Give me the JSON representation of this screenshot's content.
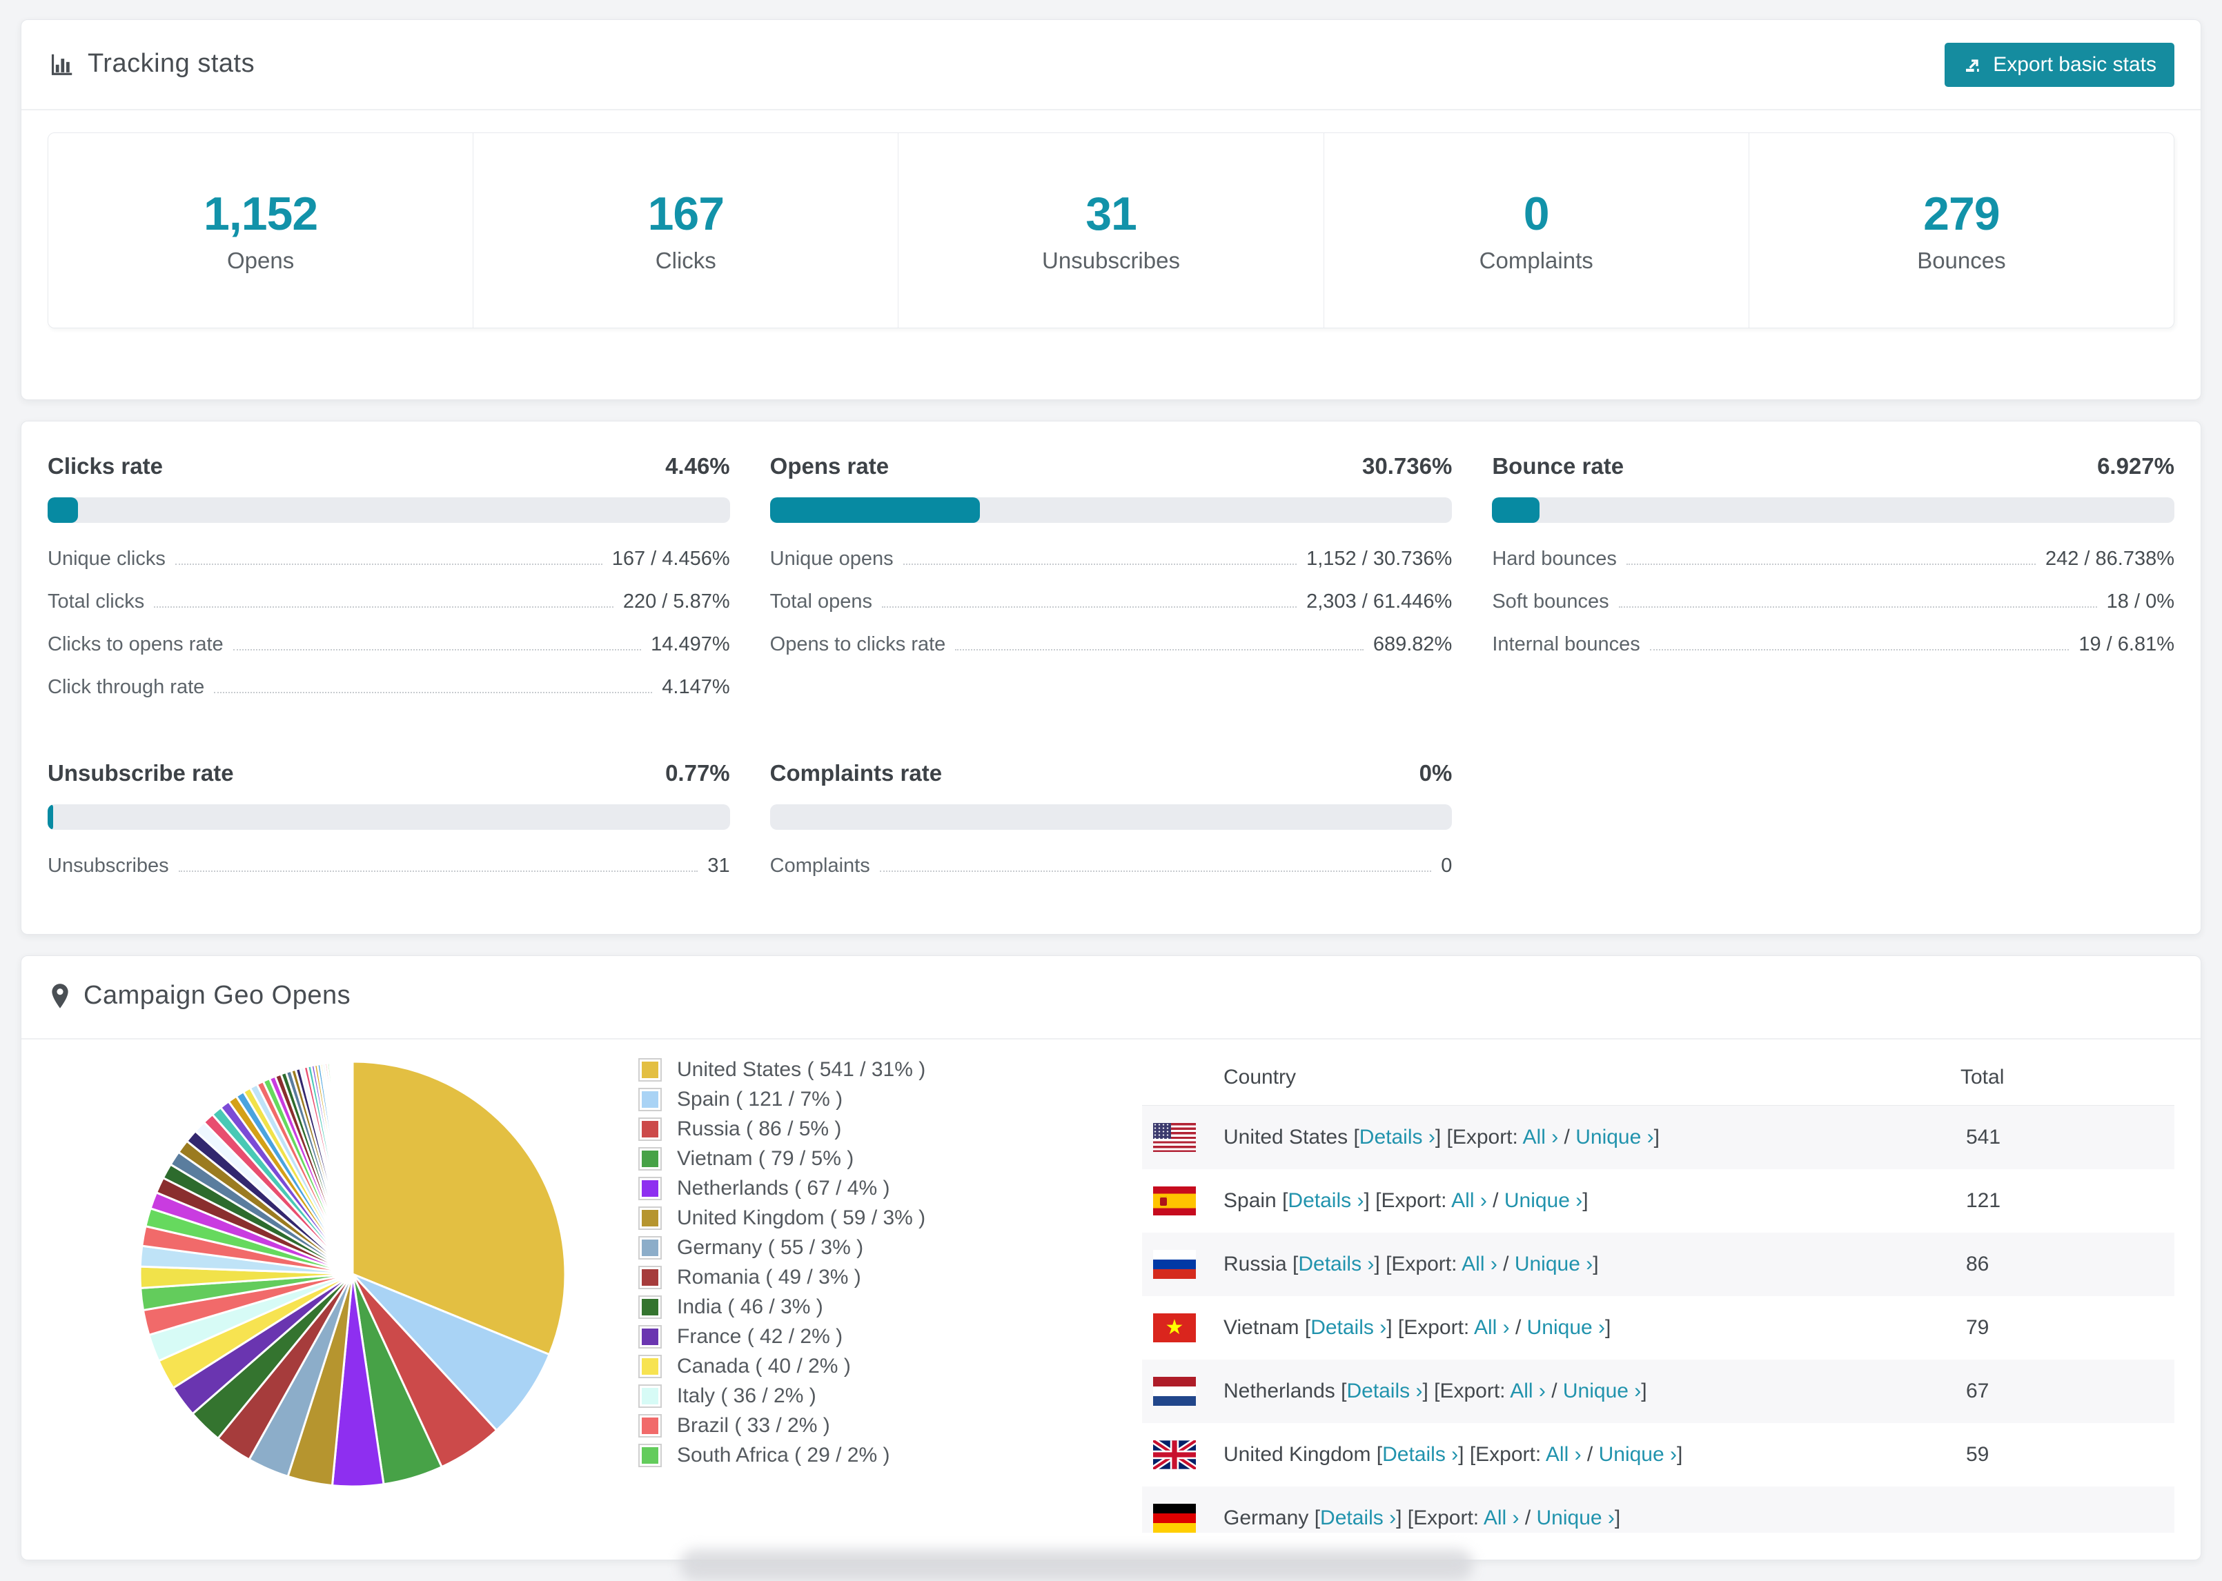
{
  "colors": {
    "accent": "#158c9f",
    "stat_number": "#1292a9",
    "bar_fill": "#078aa2",
    "bar_track": "#e9ebef",
    "link": "#2193ad"
  },
  "header": {
    "title": "Tracking stats",
    "export_label": "Export basic stats"
  },
  "summary_stats": [
    {
      "value": "1,152",
      "label": "Opens"
    },
    {
      "value": "167",
      "label": "Clicks"
    },
    {
      "value": "31",
      "label": "Unsubscribes"
    },
    {
      "value": "0",
      "label": "Complaints"
    },
    {
      "value": "279",
      "label": "Bounces"
    }
  ],
  "rates": [
    {
      "title": "Clicks rate",
      "value": "4.46%",
      "percent": 4.46,
      "rows": [
        {
          "label": "Unique clicks",
          "value": "167 / 4.456%"
        },
        {
          "label": "Total clicks",
          "value": "220 / 5.87%"
        },
        {
          "label": "Clicks to opens rate",
          "value": "14.497%"
        },
        {
          "label": "Click through rate",
          "value": "4.147%"
        }
      ]
    },
    {
      "title": "Opens rate",
      "value": "30.736%",
      "percent": 30.736,
      "rows": [
        {
          "label": "Unique opens",
          "value": "1,152 / 30.736%"
        },
        {
          "label": "Total opens",
          "value": "2,303 / 61.446%"
        },
        {
          "label": "Opens to clicks rate",
          "value": "689.82%"
        }
      ]
    },
    {
      "title": "Bounce rate",
      "value": "6.927%",
      "percent": 6.927,
      "rows": [
        {
          "label": "Hard bounces",
          "value": "242 / 86.738%"
        },
        {
          "label": "Soft bounces",
          "value": "18 / 0%"
        },
        {
          "label": "Internal bounces",
          "value": "19 / 6.81%"
        }
      ]
    },
    {
      "title": "Unsubscribe rate",
      "value": "0.77%",
      "percent": 0.77,
      "rows": [
        {
          "label": "Unsubscribes",
          "value": "31"
        }
      ]
    },
    {
      "title": "Complaints rate",
      "value": "0%",
      "percent": 0,
      "rows": [
        {
          "label": "Complaints",
          "value": "0"
        }
      ]
    }
  ],
  "geo": {
    "title": "Campaign Geo Opens",
    "table": {
      "columns": [
        "Country",
        "Total"
      ],
      "details_label": "Details ›",
      "export_prefix": "Export:",
      "all_label": "All ›",
      "separator": "/",
      "unique_label": "Unique ›",
      "rows": [
        {
          "country": "United States",
          "flag": "us",
          "total": "541"
        },
        {
          "country": "Spain",
          "flag": "es",
          "total": "121"
        },
        {
          "country": "Russia",
          "flag": "ru",
          "total": "86"
        },
        {
          "country": "Vietnam",
          "flag": "vn",
          "total": "79"
        },
        {
          "country": "Netherlands",
          "flag": "nl",
          "total": "67"
        },
        {
          "country": "United Kingdom",
          "flag": "gb",
          "total": "59"
        },
        {
          "country": "Germany",
          "flag": "de",
          "total": ""
        }
      ]
    }
  },
  "chart_data": {
    "type": "pie",
    "title": "Campaign Geo Opens",
    "legend_position": "right",
    "start_angle_deg": 0,
    "direction": "clockwise",
    "slices": [
      {
        "country": "United States",
        "value": 541,
        "pct": "31%",
        "color": "#e3bf42"
      },
      {
        "country": "Spain",
        "value": 121,
        "pct": "7%",
        "color": "#a9d3f5"
      },
      {
        "country": "Russia",
        "value": 86,
        "pct": "5%",
        "color": "#cc4a4a"
      },
      {
        "country": "Vietnam",
        "value": 79,
        "pct": "5%",
        "color": "#47a247"
      },
      {
        "country": "Netherlands",
        "value": 67,
        "pct": "4%",
        "color": "#8e2ff0"
      },
      {
        "country": "United Kingdom",
        "value": 59,
        "pct": "3%",
        "color": "#b6952f"
      },
      {
        "country": "Germany",
        "value": 55,
        "pct": "3%",
        "color": "#8cadc9"
      },
      {
        "country": "Romania",
        "value": 49,
        "pct": "3%",
        "color": "#a63c3c"
      },
      {
        "country": "India",
        "value": 46,
        "pct": "3%",
        "color": "#34742f"
      },
      {
        "country": "France",
        "value": 42,
        "pct": "2%",
        "color": "#6a35b0"
      },
      {
        "country": "Canada",
        "value": 40,
        "pct": "2%",
        "color": "#f7e351"
      },
      {
        "country": "Italy",
        "value": 36,
        "pct": "2%",
        "color": "#d7fbf6"
      },
      {
        "country": "Brazil",
        "value": 33,
        "pct": "2%",
        "color": "#f16a6a"
      },
      {
        "country": "South Africa",
        "value": 29,
        "pct": "2%",
        "color": "#63cc5c"
      }
    ],
    "other_slices_values": [
      28,
      27,
      26,
      24,
      22,
      21,
      20,
      19,
      18,
      17,
      16,
      15,
      14,
      13,
      12,
      11,
      10,
      10,
      9,
      9,
      8,
      8,
      7,
      7,
      6,
      6,
      5,
      5,
      5,
      4,
      4,
      4,
      3,
      3,
      3,
      3,
      2,
      2,
      2,
      2,
      2,
      2,
      1,
      1,
      1,
      1,
      1,
      1,
      1,
      1,
      1,
      1,
      1,
      1,
      1,
      1,
      1,
      1,
      1,
      1
    ],
    "other_palette": [
      "#f1e24a",
      "#bfe3f7",
      "#f16a6a",
      "#66d95e",
      "#c93ce0",
      "#8a2e2e",
      "#2d6b2d",
      "#5a7d9e",
      "#9b7b20",
      "#32276e",
      "#eef7ff",
      "#e84d6f",
      "#49c9b5",
      "#7b4bd6",
      "#d4a017",
      "#4aa3df"
    ]
  }
}
